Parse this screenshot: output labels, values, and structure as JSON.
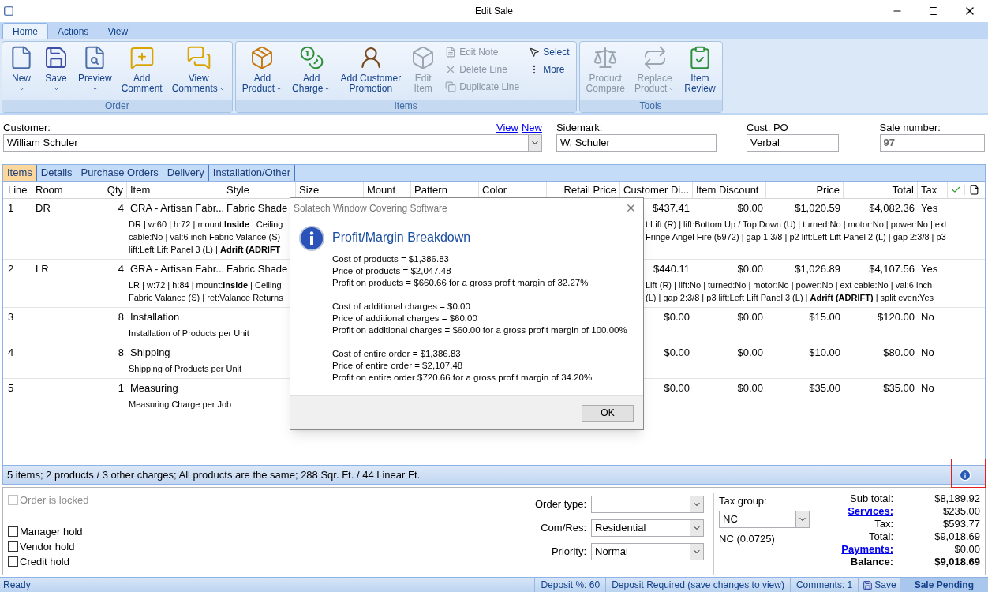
{
  "window": {
    "title": "Edit Sale"
  },
  "ribbon": {
    "tabs": [
      {
        "label": "Home",
        "selected": true
      },
      {
        "label": "Actions",
        "selected": false
      },
      {
        "label": "View",
        "selected": false
      }
    ],
    "groups": [
      {
        "label": "Order",
        "buttons": [
          {
            "kind": "large",
            "lines": [
              "New"
            ],
            "dropdown": true,
            "disabled": false
          },
          {
            "kind": "large",
            "lines": [
              "Save"
            ],
            "dropdown": true,
            "disabled": false
          },
          {
            "kind": "large",
            "lines": [
              "Preview"
            ],
            "dropdown": true,
            "disabled": false
          },
          {
            "kind": "large",
            "lines": [
              "Add",
              "Comment"
            ],
            "dropdown": false,
            "disabled": false
          },
          {
            "kind": "large",
            "lines": [
              "View",
              "Comments"
            ],
            "dropdown": true,
            "disabled": false
          }
        ]
      },
      {
        "label": "Items",
        "buttons": [
          {
            "kind": "large",
            "lines": [
              "Add",
              "Product"
            ],
            "dropdown": true,
            "disabled": false
          },
          {
            "kind": "large",
            "lines": [
              "Add",
              "Charge"
            ],
            "dropdown": true,
            "disabled": false
          },
          {
            "kind": "large",
            "lines": [
              "Add Customer",
              "Promotion"
            ],
            "dropdown": false,
            "disabled": false
          },
          {
            "kind": "large",
            "lines": [
              "Edit",
              "Item"
            ],
            "dropdown": false,
            "disabled": true
          },
          {
            "kind": "small",
            "lines": [
              "Edit Note"
            ],
            "disabled": true
          },
          {
            "kind": "small",
            "lines": [
              "Delete Line"
            ],
            "disabled": true
          },
          {
            "kind": "small",
            "lines": [
              "Duplicate Line"
            ],
            "disabled": true
          },
          {
            "kind": "small",
            "lines": [
              "Select"
            ],
            "disabled": false
          },
          {
            "kind": "small",
            "lines": [
              "More"
            ],
            "disabled": false
          }
        ]
      },
      {
        "label": "Tools",
        "buttons": [
          {
            "kind": "large",
            "lines": [
              "Product",
              "Compare"
            ],
            "dropdown": false,
            "disabled": true
          },
          {
            "kind": "large",
            "lines": [
              "Replace",
              "Product"
            ],
            "dropdown": true,
            "disabled": true
          },
          {
            "kind": "large",
            "lines": [
              "Item",
              "Review"
            ],
            "dropdown": false,
            "disabled": false
          }
        ]
      }
    ]
  },
  "header": {
    "customer": {
      "label": "Customer:",
      "value": "William Schuler",
      "links": [
        "View",
        "New"
      ]
    },
    "sidemark": {
      "label": "Sidemark:",
      "value": "W. Schuler"
    },
    "cust_po": {
      "label": "Cust. PO",
      "value": "Verbal"
    },
    "sale_number": {
      "label": "Sale number:",
      "value": "97"
    }
  },
  "tabs": [
    {
      "label": "Items",
      "selected": true
    },
    {
      "label": "Details",
      "selected": false
    },
    {
      "label": "Purchase Orders",
      "selected": false
    },
    {
      "label": "Delivery",
      "selected": false
    },
    {
      "label": "Installation/Other",
      "selected": false
    }
  ],
  "table": {
    "columns": [
      "Line",
      "Room",
      "Qty",
      "Item",
      "Style",
      "Size",
      "Mount",
      "Pattern",
      "Color",
      "Retail Price",
      "Customer Di...",
      "Item Discount",
      "Price",
      "Total",
      "Tax"
    ],
    "rows": [
      {
        "line": "1",
        "room": "DR",
        "qty": "4",
        "item": "GRA - Artisan Fabr...",
        "style": "Fabric Shade",
        "customer_discount": "$437.41",
        "item_discount": "$0.00",
        "price": "$1,020.59",
        "total": "$4,082.36",
        "tax": "Yes",
        "details": [
          {
            "left": "DR | w:60 | h:72 | mount:**Inside** | Ceiling",
            "right": "t Lift (R) | lift:Bottom Up / Top Down (U) | turned:No | motor:No | power:No | ext"
          },
          {
            "left": "cable:No | val:6 inch Fabric Valance (S)",
            "right": "Fringe Angel Fire (5972) | gap 1:3/8 | p2 lift:Left Lift Panel 2 (L) | gap 2:3/8 | p3"
          },
          {
            "left": "lift:Left Lift Panel 3 (L) | **Adrift (ADRIFT**"
          }
        ]
      },
      {
        "line": "2",
        "room": "LR",
        "qty": "4",
        "item": "GRA - Artisan Fabr...",
        "style": "Fabric Shade",
        "customer_discount": "$440.11",
        "item_discount": "$0.00",
        "price": "$1,026.89",
        "total": "$4,107.56",
        "tax": "Yes",
        "details": [
          {
            "left": "LR | w:72 | h:84 | mount:**Inside** | Ceiling",
            "right": "Lift (R) | lift:No | turned:No | motor:No | power:No | ext cable:No | val:6 inch"
          },
          {
            "left": "Fabric Valance (S) | ret:Valance Returns",
            "right": "(L) | gap 2:3/8 | p3 lift:Left Lift Panel 3 (L) | **Adrift (ADRIFT)** | split even:Yes"
          }
        ]
      },
      {
        "line": "3",
        "qty": "8",
        "item": "Installation",
        "customer_discount": "$0.00",
        "item_discount": "$0.00",
        "price": "$15.00",
        "total": "$120.00",
        "tax": "No",
        "details": [
          {
            "left": "Installation of Products per Unit"
          }
        ]
      },
      {
        "line": "4",
        "qty": "8",
        "item": "Shipping",
        "customer_discount": "$0.00",
        "item_discount": "$0.00",
        "price": "$10.00",
        "total": "$80.00",
        "tax": "No",
        "details": [
          {
            "left": "Shipping of Products per Unit"
          }
        ]
      },
      {
        "line": "5",
        "qty": "1",
        "item": "Measuring",
        "customer_discount": "$0.00",
        "item_discount": "$0.00",
        "price": "$35.00",
        "total": "$35.00",
        "tax": "No",
        "details": [
          {
            "left": "Measuring Charge per Job"
          }
        ]
      }
    ]
  },
  "summary": "5 items; 2 products / 3 other charges; All products are the same; 288 Sqr. Ft. / 44 Linear Ft.",
  "holds": [
    {
      "label": "Order is locked",
      "checked": false,
      "disabled": true
    },
    {
      "label": "Manager hold",
      "checked": false,
      "disabled": false
    },
    {
      "label": "Vendor hold",
      "checked": false,
      "disabled": false
    },
    {
      "label": "Credit hold",
      "checked": false,
      "disabled": false
    }
  ],
  "selects": [
    {
      "label": "Order type:"
    },
    {
      "label": "Com/Res:",
      "value": "Residential"
    },
    {
      "label": "Priority:",
      "value": "Normal"
    }
  ],
  "tax_group": {
    "label": "Tax group:",
    "value": "NC",
    "rate": "NC (0.0725)"
  },
  "totals": [
    {
      "kind": "plain",
      "label": "Sub total:",
      "value": "$8,189.92"
    },
    {
      "kind": "link",
      "label": "Services:",
      "value": "$235.00"
    },
    {
      "kind": "plain",
      "label": "Tax:",
      "value": "$593.77"
    },
    {
      "kind": "plain",
      "label": "Total:",
      "value": "$9,018.69"
    },
    {
      "kind": "link",
      "label": "Payments:",
      "value": "$0.00"
    },
    {
      "kind": "bold",
      "label": "Balance:",
      "value": "$9,018.69"
    }
  ],
  "status_bar": {
    "left": "Ready",
    "items": [
      "Deposit %: 60",
      "Deposit Required (save changes to view)",
      "Comments: 1"
    ],
    "save": "Save",
    "state": "Sale Pending"
  },
  "dialog": {
    "title": "Solatech Window Covering Software",
    "heading": "Profit/Margin Breakdown",
    "groups": [
      [
        "Cost of products = $1,386.83",
        "Price of products = $2,047.48",
        "Profit on products = $660.66 for a gross profit margin of 32.27%"
      ],
      [
        "Cost of additional charges = $0.00",
        "Price of additional charges = $60.00",
        "Profit on additional charges = $60.00 for a gross profit margin of 100.00%"
      ],
      [
        "Cost of entire order = $1,386.83",
        "Price of entire order = $2,107.48",
        "Profit on entire order $720.66 for a gross profit margin of 34.20%"
      ]
    ],
    "button": "OK"
  }
}
